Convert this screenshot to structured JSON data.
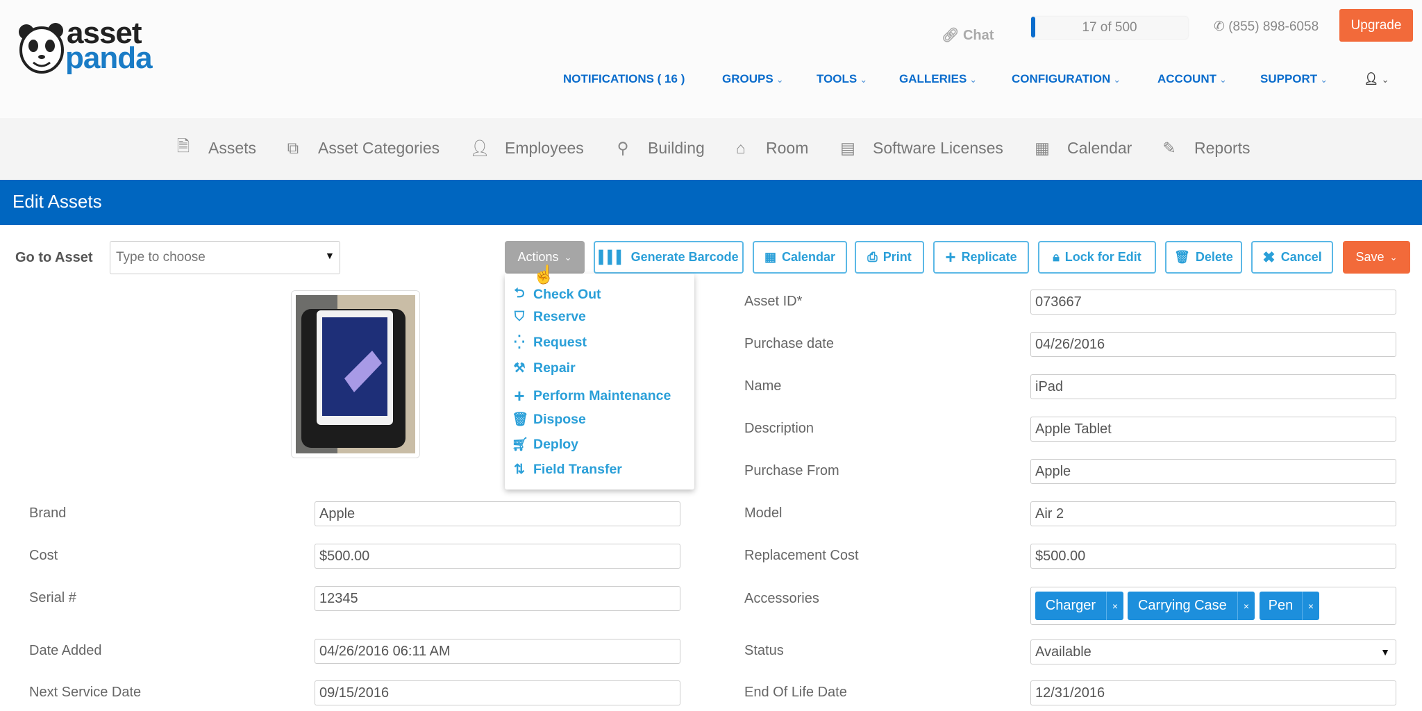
{
  "brand": {
    "logo_line1": "asset",
    "logo_line2": "panda"
  },
  "topbar": {
    "chat": "Chat",
    "usage": "17 of 500",
    "usage_fraction": 0.034,
    "phone": "(855) 898-6058",
    "upgrade": "Upgrade"
  },
  "nav": [
    {
      "label": "NOTIFICATIONS ( 16 )"
    },
    {
      "label": "GROUPS"
    },
    {
      "label": "TOOLS"
    },
    {
      "label": "GALLERIES"
    },
    {
      "label": "CONFIGURATION"
    },
    {
      "label": "ACCOUNT"
    },
    {
      "label": "SUPPORT"
    }
  ],
  "modules": [
    {
      "label": "Assets",
      "icon": "document-icon"
    },
    {
      "label": "Asset Categories",
      "icon": "categories-icon"
    },
    {
      "label": "Employees",
      "icon": "person-icon"
    },
    {
      "label": "Building",
      "icon": "map-marker-icon"
    },
    {
      "label": "Room",
      "icon": "home-icon"
    },
    {
      "label": "Software Licenses",
      "icon": "license-icon"
    },
    {
      "label": "Calendar",
      "icon": "calendar-icon"
    },
    {
      "label": "Reports",
      "icon": "edit-icon"
    }
  ],
  "page": {
    "title": "Edit Assets"
  },
  "toolbar": {
    "goto_label": "Go to Asset",
    "goto_placeholder": "Type to choose",
    "actions": "Actions",
    "generate_barcode": "Generate Barcode",
    "calendar": "Calendar",
    "print": "Print",
    "replicate": "Replicate",
    "lock": "Lock for Edit",
    "delete": "Delete",
    "cancel": "Cancel",
    "save": "Save"
  },
  "actions_menu": [
    {
      "label": "Check Out",
      "icon": "checkout-icon"
    },
    {
      "label": "Reserve",
      "icon": "shield-icon"
    },
    {
      "label": "Request",
      "icon": "request-icon"
    },
    {
      "label": "Repair",
      "icon": "tools-icon"
    },
    {
      "label": "Perform Maintenance",
      "icon": "plus-icon"
    },
    {
      "label": "Dispose",
      "icon": "trash-icon"
    },
    {
      "label": "Deploy",
      "icon": "cart-icon"
    },
    {
      "label": "Field Transfer",
      "icon": "transfer-icon"
    }
  ],
  "fields_left": [
    {
      "label": "Brand",
      "value": "Apple"
    },
    {
      "label": "Cost",
      "value": "$500.00"
    },
    {
      "label": "Serial #",
      "value": "12345"
    },
    {
      "label": "Date Added",
      "value": "04/26/2016 06:11 AM"
    },
    {
      "label": "Next Service Date",
      "value": "09/15/2016"
    }
  ],
  "fields_right": [
    {
      "label": "Asset ID*",
      "value": "073667"
    },
    {
      "label": "Purchase date",
      "value": "04/26/2016"
    },
    {
      "label": "Name",
      "value": "iPad"
    },
    {
      "label": "Description",
      "value": "Apple Tablet"
    },
    {
      "label": "Purchase From",
      "value": "Apple"
    },
    {
      "label": "Model",
      "value": "Air 2"
    },
    {
      "label": "Replacement Cost",
      "value": "$500.00"
    }
  ],
  "accessories": {
    "label": "Accessories",
    "tags": [
      "Charger",
      "Carrying Case",
      "Pen"
    ],
    "remove": "×"
  },
  "status": {
    "label": "Status",
    "value": "Available"
  },
  "end_of_life": {
    "label": "End Of Life Date",
    "value": "12/31/2016"
  },
  "colors": {
    "primary": "#0066c0",
    "accent": "#2a9fd8",
    "orange": "#f26a3a",
    "tag": "#1d8fdc"
  }
}
